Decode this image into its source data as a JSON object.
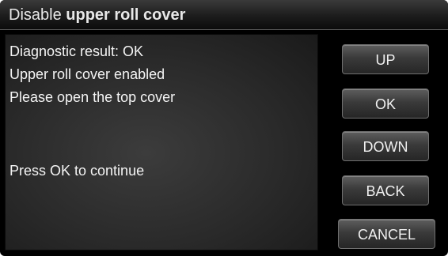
{
  "title": {
    "prefix": "Disable",
    "emphasis": "upper roll cover"
  },
  "messages": {
    "line1": "Diagnostic result: OK",
    "line2": "Upper roll cover enabled",
    "line3": "Please open the top cover",
    "line4": "Press OK to continue"
  },
  "buttons": {
    "up": "UP",
    "ok": "OK",
    "down": "DOWN",
    "back": "BACK",
    "cancel": "CANCEL"
  }
}
